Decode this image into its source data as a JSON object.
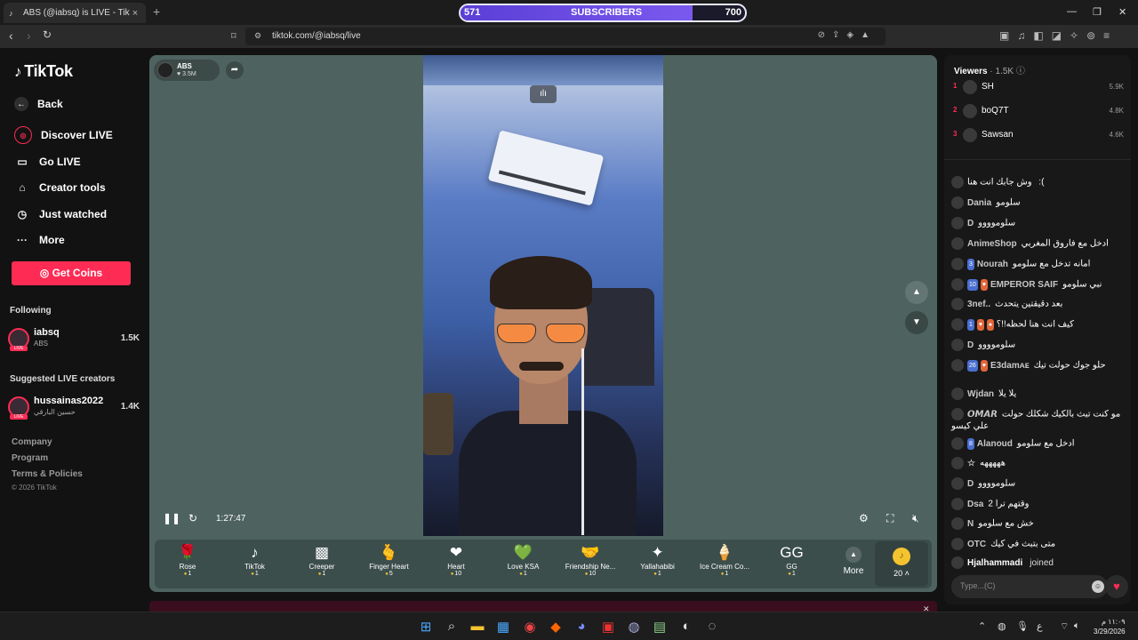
{
  "browser": {
    "tab_title": "ABS (@iabsq) is LIVE - TikTok LIVE",
    "tab_close": "×",
    "new_tab": "+",
    "url": "tiktok.com/@iabsq/live",
    "window_controls": [
      "—",
      "❐",
      "✕"
    ]
  },
  "subscriber_bar": {
    "current": "571",
    "label": "SUBSCRIBERS",
    "goal": "700",
    "progress_fraction": 0.816
  },
  "sidebar": {
    "logo": "TikTok",
    "nav": [
      {
        "label": "Back",
        "icon": "arrow-left-icon"
      },
      {
        "label": "Discover LIVE",
        "icon": "live-icon"
      },
      {
        "label": "Go LIVE",
        "icon": "camera-icon"
      },
      {
        "label": "Creator tools",
        "icon": "home-icon"
      },
      {
        "label": "Just watched",
        "icon": "history-icon"
      },
      {
        "label": "More",
        "icon": "more-icon"
      }
    ],
    "get_coins": "Get Coins",
    "following_header": "Following",
    "following": [
      {
        "name": "iabsq",
        "sub": "ABS",
        "count": "1.5K"
      }
    ],
    "suggested_header": "Suggested LIVE creators",
    "suggested": [
      {
        "name": "hussainas2022",
        "sub": "حسين البارقي",
        "count": "1.4K"
      }
    ],
    "footer_links": [
      "Company",
      "Program",
      "Terms & Policies"
    ],
    "copyright": "© 2026 TikTok"
  },
  "player": {
    "host_name": "ABS",
    "host_likes": "3.5M",
    "elapsed": "1:27:47",
    "gifts": [
      {
        "name": "Rose",
        "price": "1",
        "icon": "🌹"
      },
      {
        "name": "TikTok",
        "price": "1",
        "icon": "♪"
      },
      {
        "name": "Creeper",
        "price": "1",
        "icon": "▩"
      },
      {
        "name": "Finger Heart",
        "price": "5",
        "icon": "🫰"
      },
      {
        "name": "Heart",
        "price": "10",
        "icon": "❤"
      },
      {
        "name": "Love KSA",
        "price": "1",
        "icon": "💚"
      },
      {
        "name": "Friendship Ne...",
        "price": "10",
        "icon": "🤝"
      },
      {
        "name": "Yallahabibi",
        "price": "1",
        "icon": "✦"
      },
      {
        "name": "Ice Cream Co...",
        "price": "1",
        "icon": "🍦"
      },
      {
        "name": "GG",
        "price": "1",
        "icon": "GG"
      }
    ],
    "more_label": "More",
    "coin_balance": "20"
  },
  "chat": {
    "viewers_label": "Viewers",
    "viewers_count": "· 1.5K",
    "top_viewers": [
      {
        "rank": "1",
        "name": "SH",
        "value": "5.9K"
      },
      {
        "rank": "2",
        "name": "boQ7T",
        "value": "4.8K"
      },
      {
        "rank": "3",
        "name": "Sawsan",
        "value": "4.6K"
      }
    ],
    "messages": [
      {
        "user": "",
        "badges": [],
        "text": "وش جابك انت هنا :("
      },
      {
        "user": "Dania",
        "badges": [],
        "text": "سلومو"
      },
      {
        "user": "D",
        "badges": [],
        "text": "سلوموووو"
      },
      {
        "user": "AnimeShop",
        "badges": [],
        "text": "ادخل مع فاروق المغربي"
      },
      {
        "user": "Nourah",
        "badges": [
          "3"
        ],
        "text": "امانه تدخل مع سلومو"
      },
      {
        "user": "EMPEROR SAIF",
        "badges": [
          "10",
          "♥"
        ],
        "text": "نبي سلومو"
      },
      {
        "user": "3nef..",
        "badges": [],
        "text": "بعد دقيقتين يتحدث"
      },
      {
        "user": "",
        "badges": [
          "1",
          "♥",
          "♠"
        ],
        "text": "كيف انت هنا لحظه!!؟"
      },
      {
        "user": "D",
        "badges": [],
        "text": "سلوموووو"
      },
      {
        "user": "E3damᴀᴇ",
        "badges": [
          "26",
          "♥"
        ],
        "text": "حلو جوك حولت تيك"
      },
      {
        "user": "Wjdan",
        "badges": [],
        "text": "يلا يلا"
      },
      {
        "user": "𝙊𝙈𝘼𝙍",
        "badges": [],
        "text": "مو كنت تبث بالكيك شكلك حولت علي كيسو"
      },
      {
        "user": "Alanoud",
        "badges": [
          "8"
        ],
        "text": "ادخل مع سلومو"
      },
      {
        "user": "☆",
        "badges": [],
        "text": "هههههه"
      },
      {
        "user": "D",
        "badges": [],
        "text": "سلوموووو"
      },
      {
        "user": "Dsa",
        "badges": [],
        "text": "وقتهم ترا 2"
      },
      {
        "user": "N",
        "badges": [],
        "text": "خش مع سلومو"
      },
      {
        "user": "OTC",
        "badges": [],
        "text": "متى بتبث في كيك"
      }
    ],
    "join_event": {
      "user": "Hjalhammadi",
      "text": "joined"
    },
    "input_placeholder": "Type...(C)"
  },
  "taskbar": {
    "clock_time": "١١:٠٩ م",
    "clock_date": "3/29/2026"
  },
  "colors": {
    "brand": "#fe2c55",
    "player_bg": "#4e6360",
    "subscriber_fill": "#6b4de6"
  }
}
